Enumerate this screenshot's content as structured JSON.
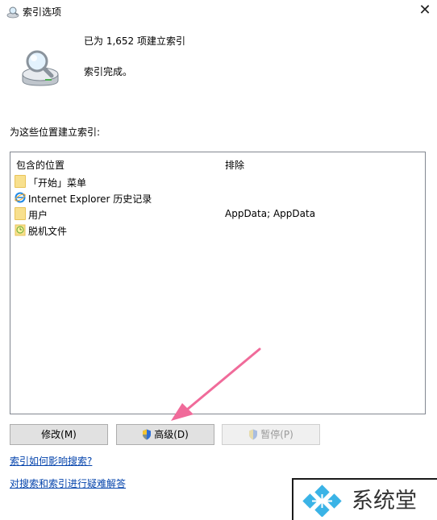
{
  "window": {
    "title": "索引选项",
    "close_glyph": "✕"
  },
  "status": {
    "count_text": "已为 1,652 项建立索引",
    "done_text": "索引完成。",
    "icon": "magnifier-drive-icon"
  },
  "locations": {
    "section_label": "为这些位置建立索引:",
    "headers": {
      "included": "包含的位置",
      "exclude": "排除"
    },
    "rows": [
      {
        "name": "「开始」菜单",
        "exclude": "",
        "icon": "folder-icon"
      },
      {
        "name": "Internet Explorer 历史记录",
        "exclude": "",
        "icon": "internet-explorer-icon"
      },
      {
        "name": "用户",
        "exclude": "AppData; AppData",
        "icon": "folder-icon"
      },
      {
        "name": "脱机文件",
        "exclude": "",
        "icon": "offline-files-icon"
      }
    ]
  },
  "buttons": {
    "modify": "修改(M)",
    "advanced": "高级(D)",
    "pause": "暂停(P)"
  },
  "links": {
    "search_effect": "索引如何影响搜索?",
    "troubleshoot": "对搜索和索引进行疑难解答"
  },
  "watermark": {
    "text": "系统堂",
    "colors": {
      "logo": "#3ab3e6",
      "text": "#333333"
    }
  },
  "annotation": {
    "color": "#f06b9a"
  }
}
